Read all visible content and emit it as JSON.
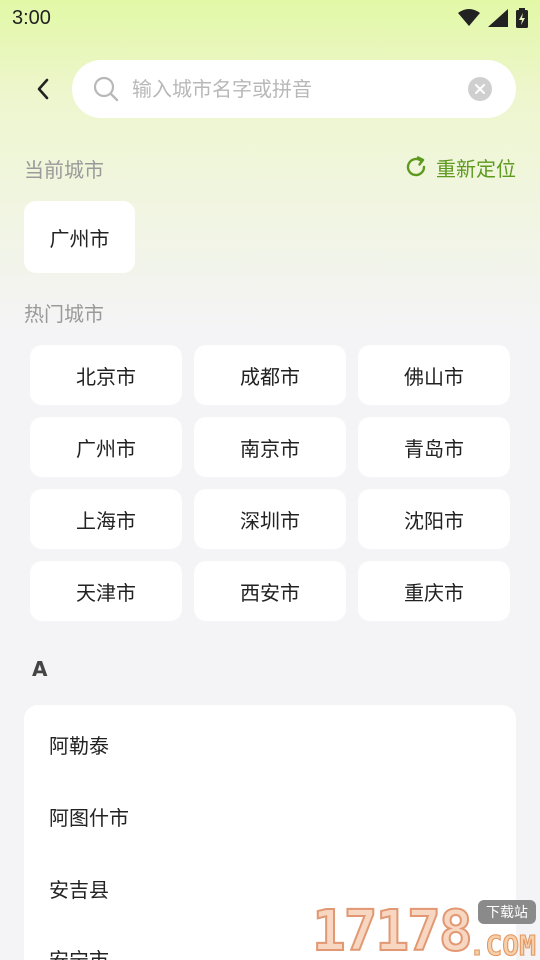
{
  "status_bar": {
    "time": "3:00"
  },
  "search": {
    "placeholder": "输入城市名字或拼音",
    "value": ""
  },
  "current_city": {
    "label": "当前城市",
    "relocate_label": "重新定位",
    "city": "广州市"
  },
  "hot_cities": {
    "label": "热门城市",
    "items": [
      "北京市",
      "成都市",
      "佛山市",
      "广州市",
      "南京市",
      "青岛市",
      "上海市",
      "深圳市",
      "沈阳市",
      "天津市",
      "西安市",
      "重庆市"
    ]
  },
  "index_section": {
    "letter": "A",
    "cities": [
      "阿勒泰",
      "阿图什市",
      "安吉县",
      "安宁市"
    ]
  },
  "watermark": {
    "number": "17178",
    "badge": "下载站",
    "suffix": ".COM"
  },
  "colors": {
    "accent": "#5e9a1f",
    "gradient_top": "#e2f8a6",
    "background": "#f4f4f6"
  },
  "icons": [
    "back-arrow-icon",
    "search-icon",
    "clear-icon",
    "refresh-icon",
    "wifi-icon",
    "signal-icon",
    "battery-icon"
  ]
}
